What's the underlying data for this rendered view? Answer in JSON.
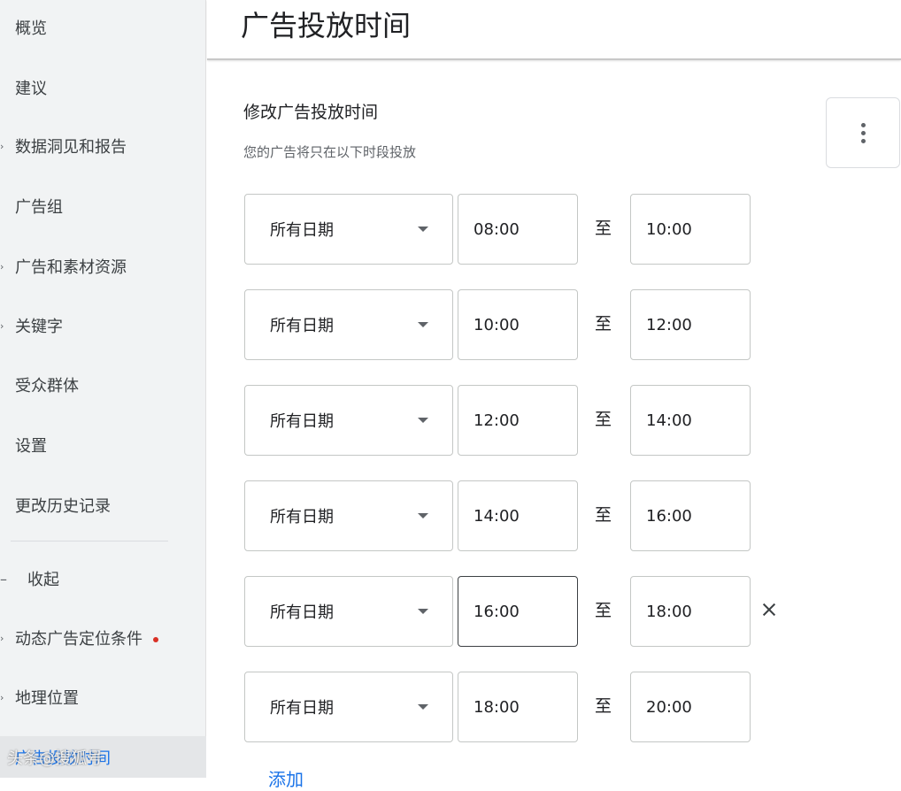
{
  "sidebar": {
    "items": [
      {
        "label": "概览",
        "caret": ""
      },
      {
        "label": "建议",
        "caret": ""
      },
      {
        "label": "数据洞见和报告",
        "caret": "›"
      },
      {
        "label": "广告组",
        "caret": ""
      },
      {
        "label": "广告和素材资源",
        "caret": "›"
      },
      {
        "label": "关键字",
        "caret": "›"
      },
      {
        "label": "受众群体",
        "caret": ""
      },
      {
        "label": "设置",
        "caret": ""
      },
      {
        "label": "更改历史记录",
        "caret": ""
      },
      {
        "label": "收起",
        "caret": "–"
      },
      {
        "label": "动态广告定位条件",
        "caret": "›"
      },
      {
        "label": "地理位置",
        "caret": "›"
      },
      {
        "label": "广告投放时间",
        "caret": ""
      }
    ],
    "watermark": "头条@搜狐号"
  },
  "header": {
    "title": "广告投放时间"
  },
  "schedule": {
    "title": "修改广告投放时间",
    "subtitle": "您的广告将只在以下时段投放",
    "to_label": "至",
    "add_label": "添加",
    "rows": [
      {
        "day": "所有日期",
        "start": "08:00",
        "end": "10:00"
      },
      {
        "day": "所有日期",
        "start": "10:00",
        "end": "12:00"
      },
      {
        "day": "所有日期",
        "start": "12:00",
        "end": "14:00"
      },
      {
        "day": "所有日期",
        "start": "14:00",
        "end": "16:00"
      },
      {
        "day": "所有日期",
        "start": "16:00",
        "end": "18:00"
      },
      {
        "day": "所有日期",
        "start": "18:00",
        "end": "20:00"
      }
    ]
  },
  "colors": {
    "accent": "#1a73e8",
    "status_dot": "#d93025",
    "sidebar_bg": "#f1f3f4"
  }
}
